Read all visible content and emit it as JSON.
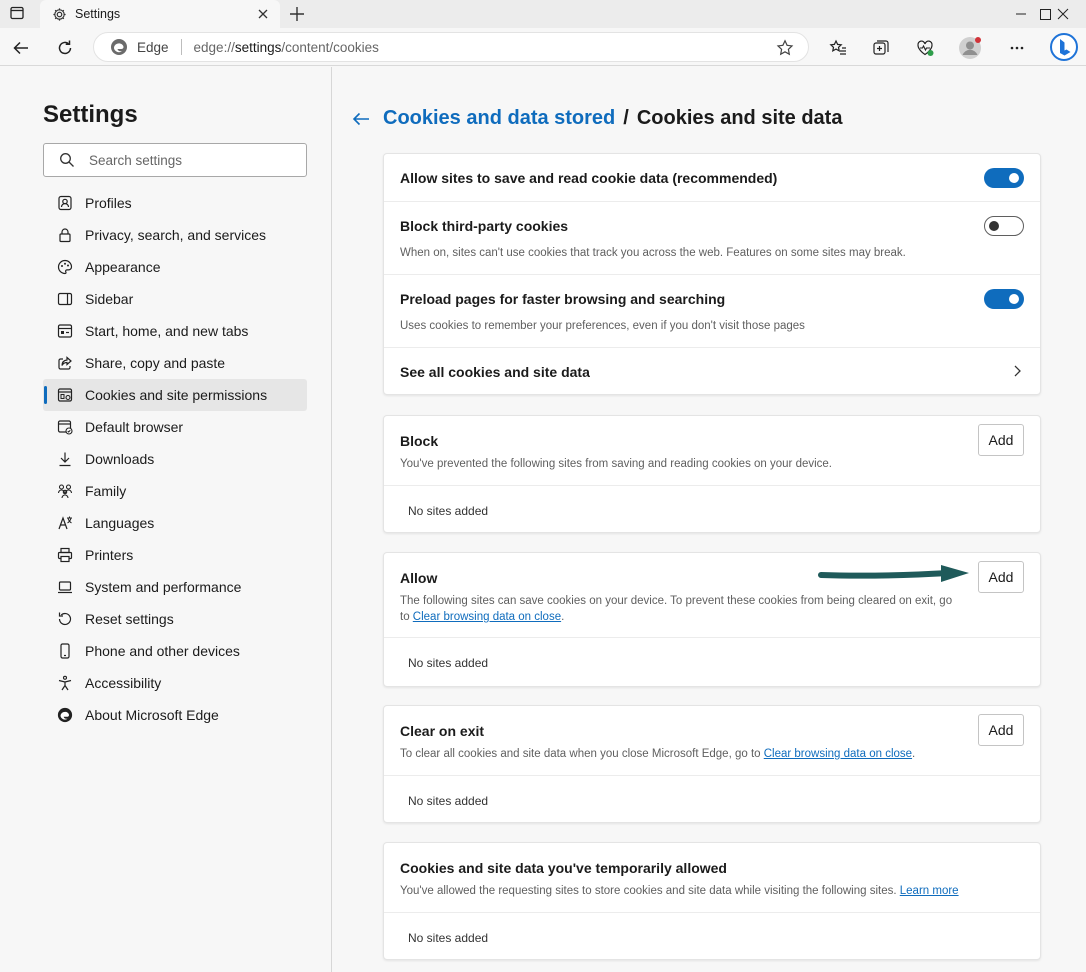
{
  "browser": {
    "tab_title": "Settings",
    "omnibox_label": "Edge",
    "url_prefix": "edge://",
    "url_bold": "settings",
    "url_rest": "/content/cookies"
  },
  "sidebar": {
    "title": "Settings",
    "search_placeholder": "Search settings",
    "items": [
      {
        "label": "Profiles",
        "icon": "profile-icon"
      },
      {
        "label": "Privacy, search, and services",
        "icon": "lock-icon"
      },
      {
        "label": "Appearance",
        "icon": "palette-icon"
      },
      {
        "label": "Sidebar",
        "icon": "sidebar-icon"
      },
      {
        "label": "Start, home, and new tabs",
        "icon": "home-tabs-icon"
      },
      {
        "label": "Share, copy and paste",
        "icon": "share-icon"
      },
      {
        "label": "Cookies and site permissions",
        "icon": "cookies-icon",
        "active": true
      },
      {
        "label": "Default browser",
        "icon": "default-browser-icon"
      },
      {
        "label": "Downloads",
        "icon": "download-icon"
      },
      {
        "label": "Family",
        "icon": "family-icon"
      },
      {
        "label": "Languages",
        "icon": "languages-icon"
      },
      {
        "label": "Printers",
        "icon": "printer-icon"
      },
      {
        "label": "System and performance",
        "icon": "laptop-icon"
      },
      {
        "label": "Reset settings",
        "icon": "reset-icon"
      },
      {
        "label": "Phone and other devices",
        "icon": "phone-icon"
      },
      {
        "label": "Accessibility",
        "icon": "accessibility-icon"
      },
      {
        "label": "About Microsoft Edge",
        "icon": "edge-logo-icon"
      }
    ]
  },
  "main": {
    "breadcrumb_parent": "Cookies and data stored",
    "breadcrumb_separator": "/",
    "breadcrumb_current": "Cookies and site data",
    "settings_card": {
      "allow_save": {
        "title": "Allow sites to save and read cookie data (recommended)",
        "enabled": true
      },
      "block_third_party": {
        "title": "Block third-party cookies",
        "desc": "When on, sites can't use cookies that track you across the web. Features on some sites may break.",
        "enabled": false
      },
      "preload": {
        "title": "Preload pages for faster browsing and searching",
        "desc": "Uses cookies to remember your preferences, even if you don't visit those pages",
        "enabled": true
      },
      "see_all": {
        "title": "See all cookies and site data"
      }
    },
    "block": {
      "title": "Block",
      "desc": "You've prevented the following sites from saving and reading cookies on your device.",
      "add_label": "Add",
      "empty": "No sites added"
    },
    "allow": {
      "title": "Allow",
      "desc_line1": "The following sites can save cookies on your device. To prevent these cookies from being cleared on exit, go",
      "desc_to": "to ",
      "desc_link": "Clear browsing data on close",
      "desc_end": ".",
      "add_label": "Add",
      "empty": "No sites added"
    },
    "clear_on_exit": {
      "title": "Clear on exit",
      "desc": "To clear all cookies and site data when you close Microsoft Edge, go to ",
      "desc_link": "Clear browsing data on close",
      "desc_end": ".",
      "add_label": "Add",
      "empty": "No sites added"
    },
    "temp_allowed": {
      "title": "Cookies and site data you've temporarily allowed",
      "desc": "You've allowed the requesting sites to store cookies and site data while visiting the following sites. ",
      "desc_link": "Learn more",
      "empty": "No sites added"
    }
  },
  "colors": {
    "accent": "#0f6cbd",
    "annotation_arrow": "#1f5a5a"
  }
}
